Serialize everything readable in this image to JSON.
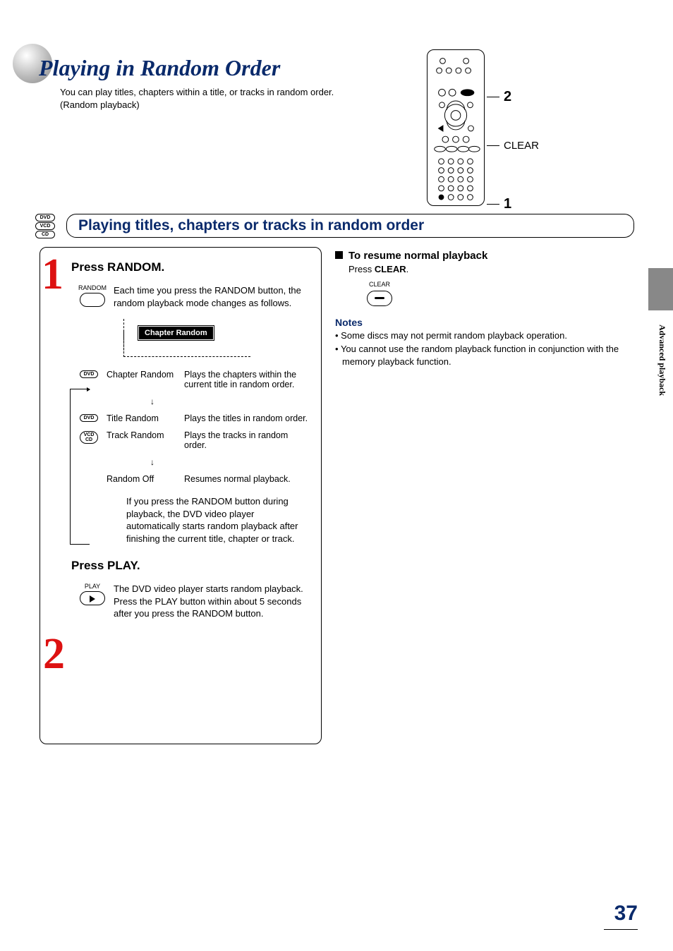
{
  "header": {
    "title": "Playing in Random Order",
    "intro_line1": "You can play titles, chapters within a title, or tracks in random order.",
    "intro_line2": "(Random playback)"
  },
  "remote_callouts": {
    "c2": "2",
    "clear": "CLEAR",
    "c1": "1"
  },
  "section": {
    "badges": [
      "DVD",
      "VCD",
      "CD"
    ],
    "heading": "Playing titles, chapters or tracks in random order"
  },
  "side_tab": "Advanced playback",
  "step1": {
    "num": "1",
    "title": "Press RANDOM.",
    "btn_label": "RANDOM",
    "desc": "Each time you press the RANDOM button, the random playback mode changes as follows.",
    "osd_chip": "Chapter Random",
    "modes": [
      {
        "badge": "DVD",
        "name": "Chapter Random",
        "desc": "Plays the chapters within the current title in random order."
      },
      {
        "badge": "DVD",
        "name": "Title Random",
        "desc": "Plays the titles in random order."
      },
      {
        "badge": "VCD/CD",
        "name": "Track Random",
        "desc": "Plays the tracks in random order."
      },
      {
        "badge": "",
        "name": "Random Off",
        "desc": "Resumes normal playback."
      }
    ],
    "bridge": "If you press the RANDOM button during playback, the DVD video player automatically starts random playback after finishing the current title, chapter or track."
  },
  "step2": {
    "num": "2",
    "title": "Press PLAY.",
    "btn_label": "PLAY",
    "desc": "The DVD video player starts random playback.\nPress the PLAY button within about 5 seconds after you press the RANDOM button."
  },
  "right": {
    "resume_title": "To resume normal playback",
    "resume_press": "Press ",
    "resume_clear": "CLEAR",
    "resume_period": ".",
    "clear_label": "CLEAR",
    "notes_heading": "Notes",
    "notes": [
      "Some discs may not permit random playback operation.",
      "You cannot use the random playback function in conjunction with the memory playback function."
    ]
  },
  "page_number": "37"
}
